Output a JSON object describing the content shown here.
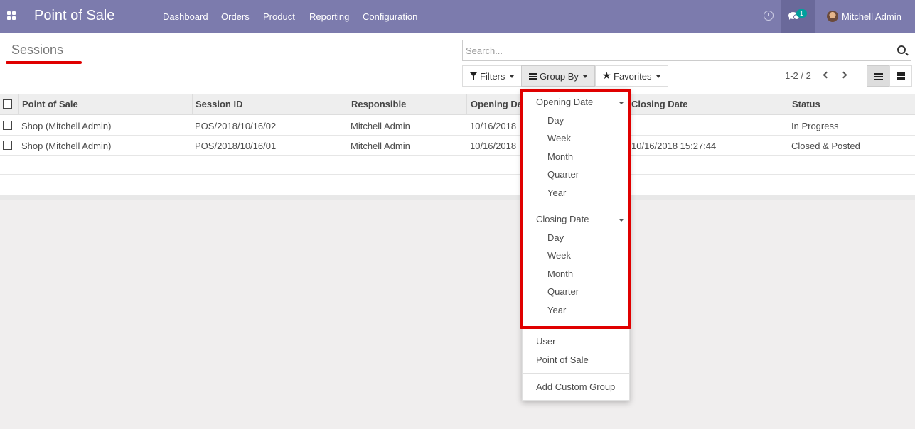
{
  "navbar": {
    "brand": "Point of Sale",
    "menu": [
      "Dashboard",
      "Orders",
      "Product",
      "Reporting",
      "Configuration"
    ],
    "chat_badge": "1",
    "user": "Mitchell Admin"
  },
  "control_panel": {
    "title": "Sessions",
    "search_placeholder": "Search...",
    "filters_label": "Filters",
    "groupby_label": "Group By",
    "favorites_label": "Favorites",
    "pager": "1-2 / 2"
  },
  "table": {
    "columns": [
      "Point of Sale",
      "Session ID",
      "Responsible",
      "Opening Date",
      "Closing Date",
      "Status"
    ],
    "rows": [
      {
        "pos": "Shop (Mitchell Admin)",
        "session": "POS/2018/10/16/02",
        "responsible": "Mitchell Admin",
        "opening": "10/16/2018",
        "closing": "",
        "status": "In Progress"
      },
      {
        "pos": "Shop (Mitchell Admin)",
        "session": "POS/2018/10/16/01",
        "responsible": "Mitchell Admin",
        "opening": "10/16/2018",
        "closing": "10/16/2018 15:27:44",
        "status": "Closed & Posted"
      }
    ]
  },
  "groupby_menu": {
    "opening_date": {
      "label": "Opening Date",
      "options": [
        "Day",
        "Week",
        "Month",
        "Quarter",
        "Year"
      ]
    },
    "closing_date": {
      "label": "Closing Date",
      "options": [
        "Day",
        "Week",
        "Month",
        "Quarter",
        "Year"
      ]
    },
    "user": "User",
    "point_of_sale": "Point of Sale",
    "add_custom_group": "Add Custom Group"
  },
  "colors": {
    "navbar": "#7c7bad",
    "highlight": "#e00000",
    "chat_badge": "#00a09d"
  }
}
